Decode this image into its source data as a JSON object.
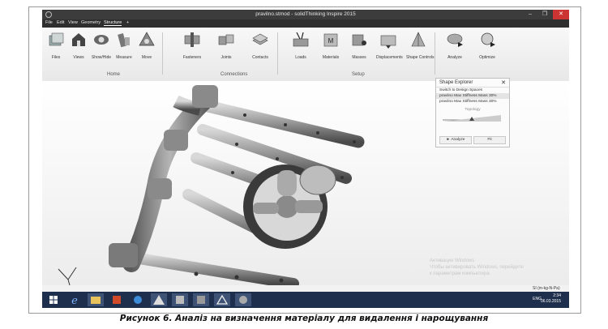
{
  "window": {
    "title": "pravilno.stmod - solidThinking Inspire 2015",
    "min": "–",
    "max": "❐",
    "close": "✕"
  },
  "menu": [
    "File",
    "Edit",
    "View",
    "Geometry",
    "Structure",
    "+"
  ],
  "ribbon": {
    "tools": [
      "Files",
      "Views",
      "Show/Hide",
      "Measure",
      "Move",
      "Fasteners",
      "Joints",
      "Contacts",
      "Loads",
      "Materials",
      "Masses",
      "Displacements",
      "Shape Controls",
      "Analyze",
      "Optimize"
    ],
    "groups": [
      "Home",
      "Connections",
      "Setup"
    ]
  },
  "shape_explorer": {
    "title": "Shape Explorer",
    "close": "✕",
    "rows": [
      "Switch to Design Spaces",
      "pravilno Max Stiffness Mass 30%",
      "pravilno Max Stiffness Mass 30%"
    ],
    "topology": "Topology",
    "analyze": "► Analyze",
    "fit": "Fit"
  },
  "watermark": [
    "Активация Windows",
    "Чтобы активировать Windows, перейдите",
    "к параметрам компьютера."
  ],
  "units": "SI (m-kg-N-Pa)",
  "tray": {
    "lang": "ENG",
    "time": "2:34",
    "date": "06.03.2015"
  },
  "caption": "Рисунок 6. Аналіз на визначення матеріалу для видалення і нарощування"
}
